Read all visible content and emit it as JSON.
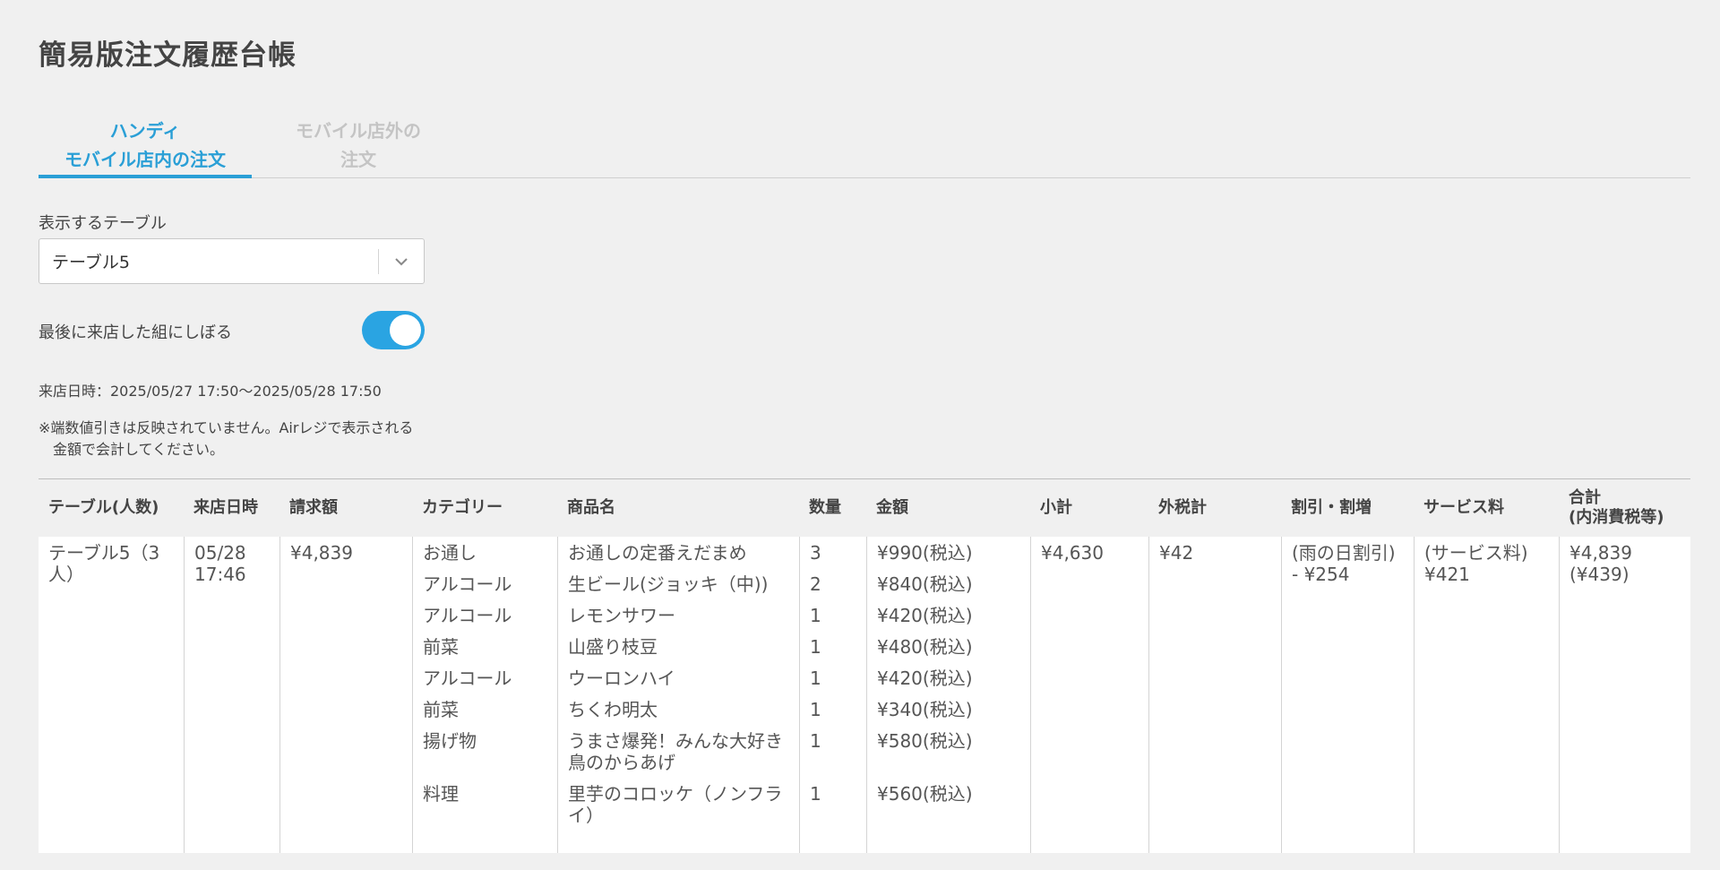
{
  "page": {
    "title": "簡易版注文履歴台帳"
  },
  "tabs": [
    {
      "line1": "ハンディ",
      "line2": "モバイル店内の注文"
    },
    {
      "line1": "モバイル店外の",
      "line2": "注文"
    }
  ],
  "table_select": {
    "label": "表示するテーブル",
    "value": "テーブル5"
  },
  "toggle": {
    "label": "最後に来店した組にしぼる",
    "state": "on"
  },
  "visit_info": "来店日時：2025/05/27 17:50〜2025/05/28 17:50",
  "note": {
    "line1": "※端数値引きは反映されていません。Airレジで表示される",
    "line2": "金額で会計してください。"
  },
  "colors": {
    "accent": "#2a9fd6",
    "toggle_on": "#2aa4e2"
  },
  "orders": {
    "headers": [
      "テーブル(人数)",
      "来店日時",
      "請求額",
      "カテゴリー",
      "商品名",
      "数量",
      "金額",
      "小計",
      "外税計",
      "割引・割増",
      "サービス料",
      "合計",
      "(内消費税等)"
    ],
    "row": {
      "table": "テーブル5（3人）",
      "date": "05/28",
      "time": "17:46",
      "billed": "¥4,839",
      "items": [
        {
          "category": "お通し",
          "name": "お通しの定番えだまめ",
          "qty": "3",
          "amount": "¥990(税込)"
        },
        {
          "category": "アルコール",
          "name": "生ビール(ジョッキ（中))",
          "qty": "2",
          "amount": "¥840(税込)"
        },
        {
          "category": "アルコール",
          "name": "レモンサワー",
          "qty": "1",
          "amount": "¥420(税込)"
        },
        {
          "category": "前菜",
          "name": "山盛り枝豆",
          "qty": "1",
          "amount": "¥480(税込)"
        },
        {
          "category": "アルコール",
          "name": "ウーロンハイ",
          "qty": "1",
          "amount": "¥420(税込)"
        },
        {
          "category": "前菜",
          "name": "ちくわ明太",
          "qty": "1",
          "amount": "¥340(税込)"
        },
        {
          "category": "揚げ物",
          "name": "うまさ爆発！みんな大好き鳥のからあげ",
          "qty": "1",
          "amount": "¥580(税込)"
        },
        {
          "category": "料理",
          "name": "里芋のコロッケ（ノンフライ）",
          "qty": "1",
          "amount": "¥560(税込)"
        }
      ],
      "subtotal": "¥4,630",
      "outer_tax": "¥42",
      "discount_label": "(雨の日割引)",
      "discount_value": "- ¥254",
      "service_label": "(サービス料)",
      "service_value": "¥421",
      "total": "¥4,839",
      "total_tax": "(¥439)"
    }
  }
}
